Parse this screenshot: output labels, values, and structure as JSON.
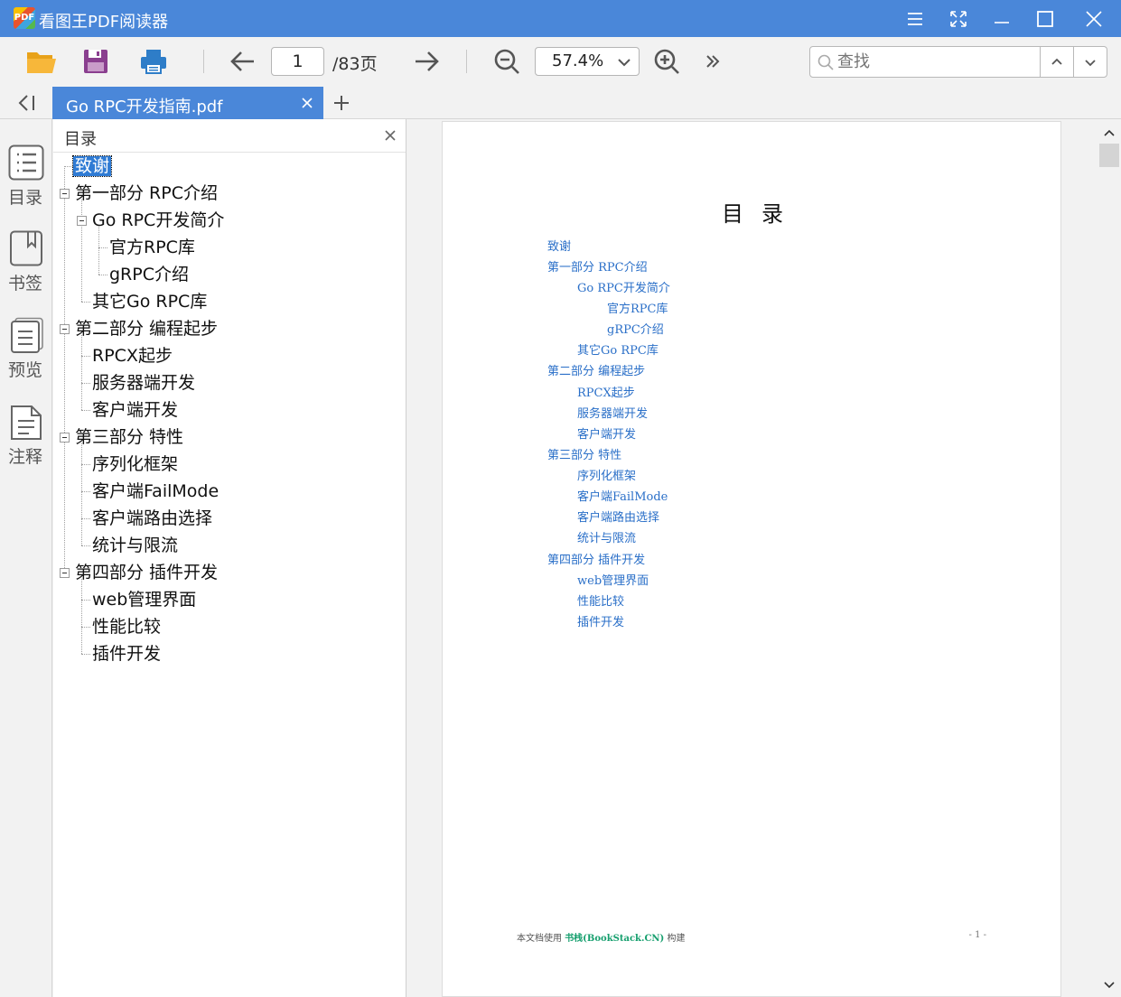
{
  "window": {
    "app_title": "看图王PDF阅读器",
    "logo_text": "PDF"
  },
  "toolbar": {
    "current_page": "1",
    "page_total": "/83页",
    "zoom": "57.4%",
    "search_placeholder": "查找"
  },
  "tabs": [
    {
      "label": "Go RPC开发指南.pdf",
      "active": true
    }
  ],
  "sidebar": {
    "items": [
      {
        "label": "目录",
        "icon": "list-icon",
        "active": true
      },
      {
        "label": "书签",
        "icon": "bookmark-icon"
      },
      {
        "label": "预览",
        "icon": "preview-icon"
      },
      {
        "label": "注释",
        "icon": "annotation-icon"
      }
    ]
  },
  "toc_panel": {
    "title": "目录",
    "items": [
      {
        "label": "致谢",
        "level": 0,
        "selected": true
      },
      {
        "label": "第一部分 RPC介绍",
        "level": 0,
        "expandable": true
      },
      {
        "label": "Go RPC开发简介",
        "level": 1,
        "expandable": true
      },
      {
        "label": "官方RPC库",
        "level": 2
      },
      {
        "label": "gRPC介绍",
        "level": 2
      },
      {
        "label": "其它Go RPC库",
        "level": 1
      },
      {
        "label": "第二部分 编程起步",
        "level": 0,
        "expandable": true
      },
      {
        "label": "RPCX起步",
        "level": 1
      },
      {
        "label": "服务器端开发",
        "level": 1
      },
      {
        "label": "客户端开发",
        "level": 1
      },
      {
        "label": "第三部分 特性",
        "level": 0,
        "expandable": true
      },
      {
        "label": "序列化框架",
        "level": 1
      },
      {
        "label": "客户端FailMode",
        "level": 1
      },
      {
        "label": "客户端路由选择",
        "level": 1
      },
      {
        "label": "统计与限流",
        "level": 1
      },
      {
        "label": "第四部分 插件开发",
        "level": 0,
        "expandable": true
      },
      {
        "label": "web管理界面",
        "level": 1
      },
      {
        "label": "性能比较",
        "level": 1
      },
      {
        "label": "插件开发",
        "level": 1
      }
    ]
  },
  "document": {
    "title": "目录",
    "entries": [
      {
        "label": "致谢",
        "level": 0
      },
      {
        "label": "第一部分 RPC介绍",
        "level": 0
      },
      {
        "label": "Go RPC开发简介",
        "level": 1
      },
      {
        "label": "官方RPC库",
        "level": 2
      },
      {
        "label": "gRPC介绍",
        "level": 2
      },
      {
        "label": "其它Go RPC库",
        "level": 1
      },
      {
        "label": "第二部分 编程起步",
        "level": 0
      },
      {
        "label": "RPCX起步",
        "level": 1
      },
      {
        "label": "服务器端开发",
        "level": 1
      },
      {
        "label": "客户端开发",
        "level": 1
      },
      {
        "label": "第三部分 特性",
        "level": 0
      },
      {
        "label": "序列化框架",
        "level": 1
      },
      {
        "label": "客户端FailMode",
        "level": 1
      },
      {
        "label": "客户端路由选择",
        "level": 1
      },
      {
        "label": "统计与限流",
        "level": 1
      },
      {
        "label": "第四部分 插件开发",
        "level": 0
      },
      {
        "label": "web管理界面",
        "level": 1
      },
      {
        "label": "性能比较",
        "level": 1
      },
      {
        "label": "插件开发",
        "level": 1
      }
    ],
    "footer_prefix": "本文档使用",
    "footer_brand": "书栈(BookStack.CN)",
    "footer_suffix": "构建",
    "page_label": "- 1 -"
  },
  "colors": {
    "accent": "#4a87d9",
    "link": "#2a6fc8",
    "brand_green": "#169f6e"
  }
}
